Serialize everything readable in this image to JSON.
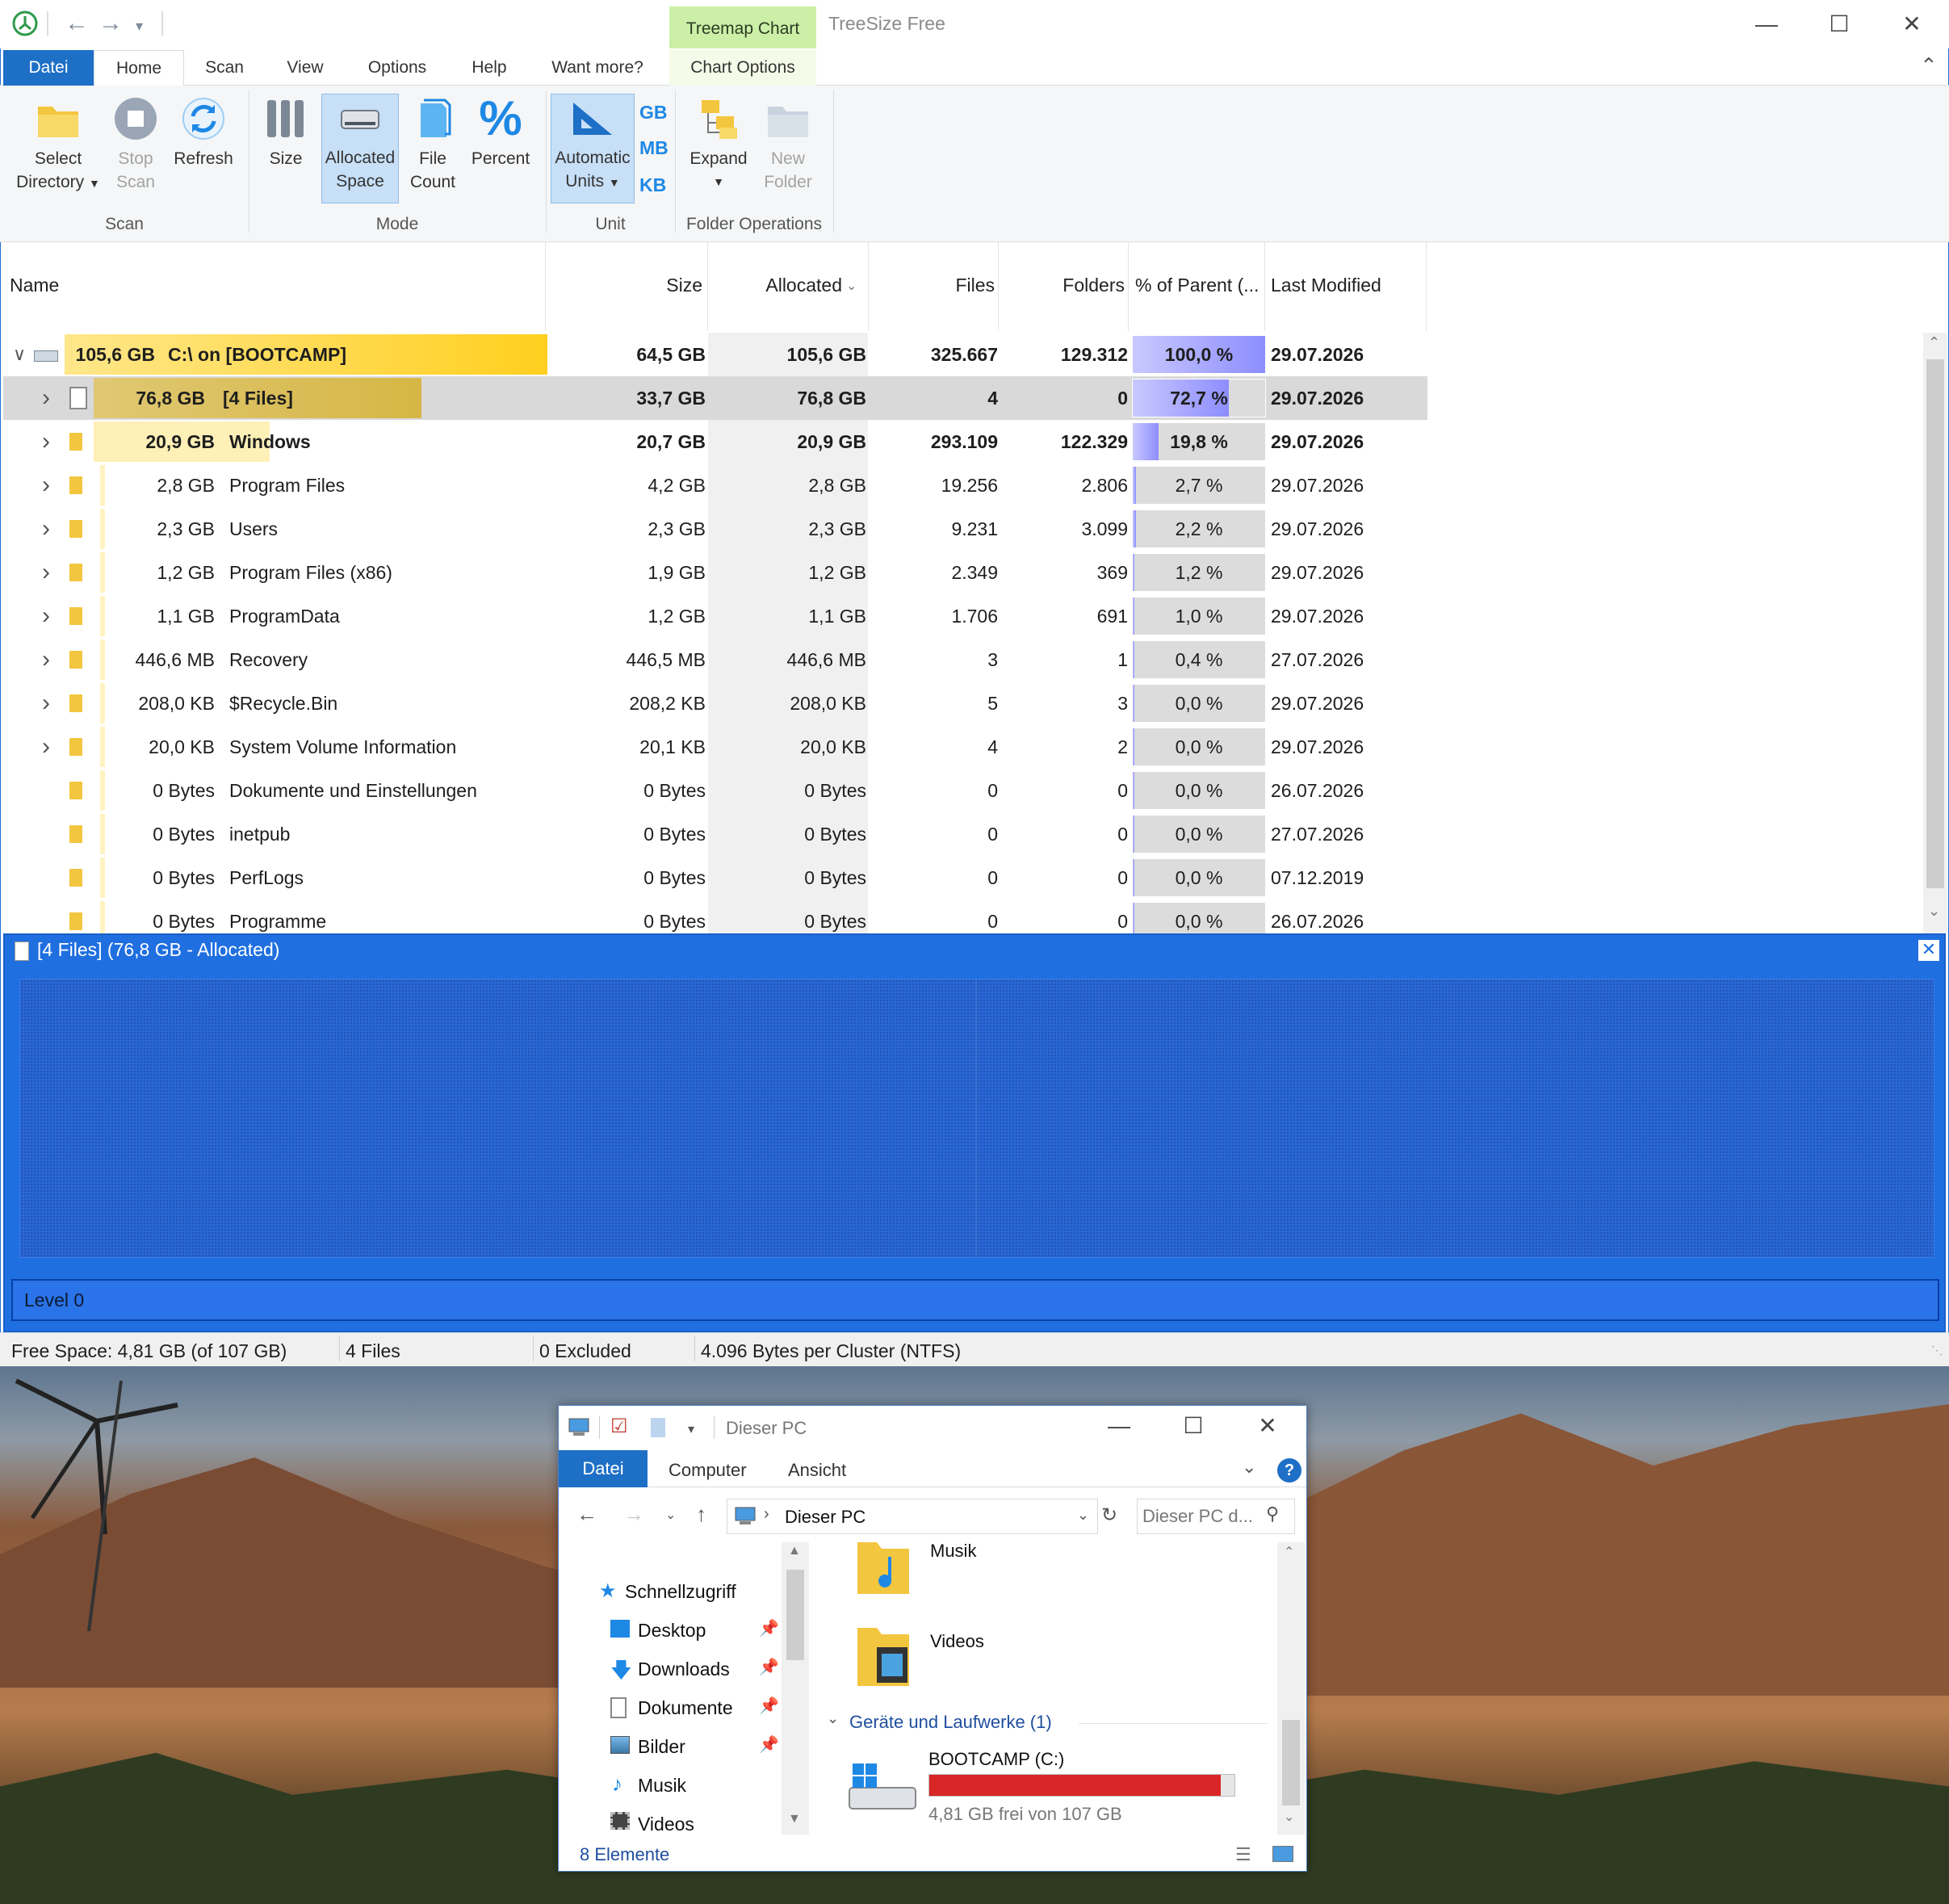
{
  "treesize": {
    "window_title": "TreeSize Free",
    "context_tab": "Treemap Chart",
    "tabs": [
      "Datei",
      "Home",
      "Scan",
      "View",
      "Options",
      "Help",
      "Want more?",
      "Chart Options"
    ],
    "ribbon": {
      "select_dir_l1": "Select",
      "select_dir_l2": "Directory",
      "stop_l1": "Stop",
      "stop_l2": "Scan",
      "refresh": "Refresh",
      "size": "Size",
      "alloc_l1": "Allocated",
      "alloc_l2": "Space",
      "filecount_l1": "File",
      "filecount_l2": "Count",
      "percent": "Percent",
      "auto_l1": "Automatic",
      "auto_l2": "Units",
      "unit_gb": "GB",
      "unit_mb": "MB",
      "unit_kb": "KB",
      "expand": "Expand",
      "newfolder_l1": "New",
      "newfolder_l2": "Folder",
      "group_scan": "Scan",
      "group_mode": "Mode",
      "group_unit": "Unit",
      "group_folder": "Folder Operations"
    },
    "columns": {
      "name": "Name",
      "size": "Size",
      "allocated": "Allocated",
      "files": "Files",
      "folders": "Folders",
      "pct": "% of Parent (...",
      "modified": "Last Modified"
    },
    "rows": [
      {
        "bar": "105,6 GB",
        "name": "C:\\  on  [BOOTCAMP]",
        "size": "64,5 GB",
        "alloc": "105,6 GB",
        "files": "325.667",
        "folders": "129.312",
        "pct": "100,0 %",
        "pct_value": 1.0,
        "date": "29.07.2026"
      },
      {
        "bar": "76,8 GB",
        "name": "[4 Files]",
        "size": "33,7 GB",
        "alloc": "76,8 GB",
        "files": "4",
        "folders": "0",
        "pct": "72,7 %",
        "pct_value": 0.727,
        "date": "29.07.2026"
      },
      {
        "bar": "20,9 GB",
        "name": "Windows",
        "size": "20,7 GB",
        "alloc": "20,9 GB",
        "files": "293.109",
        "folders": "122.329",
        "pct": "19,8 %",
        "pct_value": 0.198,
        "date": "29.07.2026"
      },
      {
        "bar": "2,8 GB",
        "name": "Program Files",
        "size": "4,2 GB",
        "alloc": "2,8 GB",
        "files": "19.256",
        "folders": "2.806",
        "pct": "2,7 %",
        "pct_value": 0.027,
        "date": "29.07.2026"
      },
      {
        "bar": "2,3 GB",
        "name": "Users",
        "size": "2,3 GB",
        "alloc": "2,3 GB",
        "files": "9.231",
        "folders": "3.099",
        "pct": "2,2 %",
        "pct_value": 0.022,
        "date": "29.07.2026"
      },
      {
        "bar": "1,2 GB",
        "name": "Program Files (x86)",
        "size": "1,9 GB",
        "alloc": "1,2 GB",
        "files": "2.349",
        "folders": "369",
        "pct": "1,2 %",
        "pct_value": 0.012,
        "date": "29.07.2026"
      },
      {
        "bar": "1,1 GB",
        "name": "ProgramData",
        "size": "1,2 GB",
        "alloc": "1,1 GB",
        "files": "1.706",
        "folders": "691",
        "pct": "1,0 %",
        "pct_value": 0.01,
        "date": "29.07.2026"
      },
      {
        "bar": "446,6 MB",
        "name": "Recovery",
        "size": "446,5 MB",
        "alloc": "446,6 MB",
        "files": "3",
        "folders": "1",
        "pct": "0,4 %",
        "pct_value": 0.004,
        "date": "27.07.2026"
      },
      {
        "bar": "208,0 KB",
        "name": "$Recycle.Bin",
        "size": "208,2 KB",
        "alloc": "208,0 KB",
        "files": "5",
        "folders": "3",
        "pct": "0,0 %",
        "pct_value": 0.0,
        "date": "29.07.2026"
      },
      {
        "bar": "20,0 KB",
        "name": "System Volume Information",
        "size": "20,1 KB",
        "alloc": "20,0 KB",
        "files": "4",
        "folders": "2",
        "pct": "0,0 %",
        "pct_value": 0.0,
        "date": "29.07.2026"
      },
      {
        "bar": "0 Bytes",
        "name": "Dokumente und Einstellungen",
        "size": "0 Bytes",
        "alloc": "0 Bytes",
        "files": "0",
        "folders": "0",
        "pct": "0,0 %",
        "pct_value": 0.0,
        "date": "26.07.2026"
      },
      {
        "bar": "0 Bytes",
        "name": "inetpub",
        "size": "0 Bytes",
        "alloc": "0 Bytes",
        "files": "0",
        "folders": "0",
        "pct": "0,0 %",
        "pct_value": 0.0,
        "date": "27.07.2026"
      },
      {
        "bar": "0 Bytes",
        "name": "PerfLogs",
        "size": "0 Bytes",
        "alloc": "0 Bytes",
        "files": "0",
        "folders": "0",
        "pct": "0,0 %",
        "pct_value": 0.0,
        "date": "07.12.2019"
      },
      {
        "bar": "0 Bytes",
        "name": "Programme",
        "size": "0 Bytes",
        "alloc": "0 Bytes",
        "files": "0",
        "folders": "0",
        "pct": "0,0 %",
        "pct_value": 0.0,
        "date": "26.07.2026"
      }
    ],
    "treemap": {
      "title": "[4 Files] (76,8 GB - Allocated)",
      "level": "Level 0"
    },
    "status": {
      "free": "Free Space: 4,81 GB  (of 107 GB)",
      "files": "4 Files",
      "excluded": "0 Excluded",
      "cluster": "4.096 Bytes per Cluster (NTFS)"
    },
    "colors": {
      "accent": "#1e6fc6",
      "treemap": "#1f6fe0",
      "bar_root": "#ffcf1f",
      "bar_sel": "#d6b645",
      "pct_fill": "#8d8dff"
    }
  },
  "explorer": {
    "title": "Dieser PC",
    "tabs": [
      "Datei",
      "Computer",
      "Ansicht"
    ],
    "address": "Dieser PC",
    "search_placeholder": "Dieser PC d...",
    "nav": [
      "Schnellzugriff",
      "Desktop",
      "Downloads",
      "Dokumente",
      "Bilder",
      "Musik",
      "Videos"
    ],
    "folders": [
      "Musik",
      "Videos"
    ],
    "section": "Geräte und Laufwerke (1)",
    "drive_name": "BOOTCAMP (C:)",
    "drive_free": "4,81 GB frei von 107 GB",
    "drive_used_fraction": 0.955,
    "status": "8 Elemente"
  }
}
